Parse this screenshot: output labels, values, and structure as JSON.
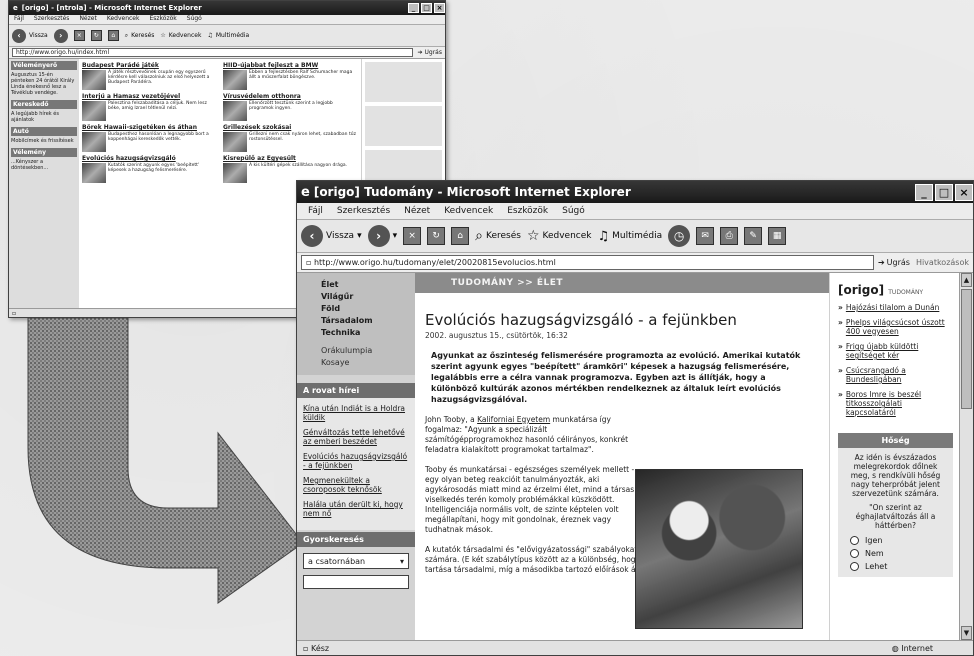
{
  "small_window": {
    "title": "[origo] - [ntrola] - Microsoft Internet Explorer",
    "menu": [
      "Fájl",
      "Szerkesztés",
      "Nézet",
      "Kedvencek",
      "Eszközök",
      "Súgó"
    ],
    "toolbar": {
      "back": "Vissza",
      "search": "Keresés",
      "favorites": "Kedvencek",
      "media": "Multimédia"
    },
    "address": "http://www.origo.hu/index.html",
    "go": "Ugrás",
    "left_sections": [
      {
        "head": "Véleményerő",
        "text": "Augusztus 15-én pénteken 24 órától Király Linda énekesnő lesz a Tévéklub vendége."
      },
      {
        "head": "Kereskedő",
        "text": "A legújabb hírek és ajánlatok"
      },
      {
        "head": "Autó",
        "text": "Mobilcímek és frissítések"
      },
      {
        "head": "Vélemény",
        "text": "...Kényszer a döntésekben..."
      }
    ],
    "news": [
      {
        "title": "Budapest Parádé játék",
        "text": "A játék résztvevőinek csupán egy egyszerű kérdésre kell válaszolniuk az első helyezett a Budapest Parádéra."
      },
      {
        "title": "HIID-újabbat fejleszt a BMW",
        "text": "Ebben a fejlesztésben Ralf Schumacher maga állt a műszerfalat böngészve."
      },
      {
        "title": "Interjú a Hamasz vezetőjével",
        "text": "Palesztina felszabadítása a céljuk. Nem lesz béke, amíg Izrael tétlenül nézi."
      },
      {
        "title": "Vírusvédelem otthonra",
        "text": "Ellenőrzött tesztünk szerint a legjobb programok ingyen."
      },
      {
        "title": "Börek Hawaii-szigetéken és áthan",
        "text": "Budapesthez hasonlóan a legnagyobb bort a koppenhágai kereskedők vették."
      },
      {
        "title": "Grillezések szokásai",
        "text": "Grillezni nem csak nyáron lehet, szabadban tűz rostonsütéssel."
      },
      {
        "title": "Evolúciós hazugságvizsgáló",
        "text": "Kutatók szerint agyunk egyes 'beépített' képesek a hazugság felismerésére."
      },
      {
        "title": "Kisrepülő az Egyesült",
        "text": "A kis kültéri gépek szállítása nagyon drága."
      }
    ],
    "status": ""
  },
  "big_window": {
    "title": "[origo] Tudomány - Microsoft Internet Explorer",
    "menu": [
      "Fájl",
      "Szerkesztés",
      "Nézet",
      "Kedvencek",
      "Eszközök",
      "Súgó"
    ],
    "toolbar": {
      "back": "Vissza",
      "search": "Keresés",
      "favorites": "Kedvencek",
      "media": "Multimédia"
    },
    "address": "http://www.origo.hu/tudomany/elet/20020815evolucios.html",
    "go": "Ugrás",
    "links_label": "Hivatkozások",
    "nav": [
      "Élet",
      "Világűr",
      "Föld",
      "Társadalom",
      "Technika"
    ],
    "nav_sub": [
      "Orákulumpia",
      "Kosaye"
    ],
    "rovat_head": "A rovat hírei",
    "rovat_links": [
      "Kína után Indiát is a Holdra küldik",
      "Génváltozás tette lehetővé az emberi beszédet",
      "Evolúciós hazugságvizsgáló - a fejünkben",
      "Megmenekültek a csoroposok teknősök",
      "Halála után derült ki, hogy nem nő"
    ],
    "search_head": "Gyorskeresés",
    "search_select": "a csatornában",
    "banner": "TUDOMÁNY >> ÉLET",
    "headline": "Evolúciós hazugságvizsgáló - a fejünkben",
    "date": "2002. augusztus 15., csütörtök, 16:32",
    "lead": "Agyunkat az őszinteség felismerésére programozta az evolúció. Amerikai kutatók szerint agyunk egyes \"beépített\" áramköri\" képesek a hazugság felismerésére, legalábbis erre a célra vannak programozva. Egyben azt is állítják, hogy a különböző kultúrák azonos mértékben rendelkeznek az általuk leírt evolúciós hazugságvizsgálóval.",
    "para1_pre": "John Tooby, a ",
    "para1_link": "Kaliforniai Egyetem",
    "para1_post": " munkatársa így fogalmaz: \"Agyunk a speciálizált számítógépprogramokhoz hasonló célirányos, konkrét feladatra kialakított programokat tartalmaz\".",
    "para2": "Tooby és munkatársai - egészséges személyek mellett - egy olyan beteg reakcióit tanulmányozták, aki agykárosodás miatt mind az érzelmi élet, mind a társas viselkedés terén komoly problémákkal küszködött. Intelligenciája normális volt, de szinte képtelen volt megállapítani, hogy mit gondolnak, éreznek vagy tudhatnak mások.",
    "para3": "A kutatók társadalmi és \"elővigyázatossági\" szabályokat fogalmaztak meg kísérleti alanyuk számára. (E két szabálytípus között az a különbség, hogy az első szabálycsoport be nem tartása társadalmi, míg a másodikba tartozó előírások áthágása fizikai következményeket von",
    "right_brand": "[origo]",
    "right_brand_sub": "TUDOMÁNY",
    "right_links": [
      "Hajózási tilalom a Dunán",
      "Phelps világcsúcsot úszott 400 vegyesen",
      "Frigg újabb küldötti segítséget kér",
      "Csúcsrangadó a Bundesligában",
      "Boros Imre is beszél titkosszolgálati kapcsolatáról"
    ],
    "poll_head": "Hőség",
    "poll_text": "Az idén is évszázados melegrekordok dőlnek meg, s rendkívüli hőség nagy teherpróbát jelent szervezetünk számára.",
    "poll_question": "\"On szerint az éghajlatváltozás áll a háttérben?",
    "poll_options": [
      "Igen",
      "Nem",
      "Lehet"
    ],
    "status_left": "Kész",
    "status_right": "Internet"
  }
}
